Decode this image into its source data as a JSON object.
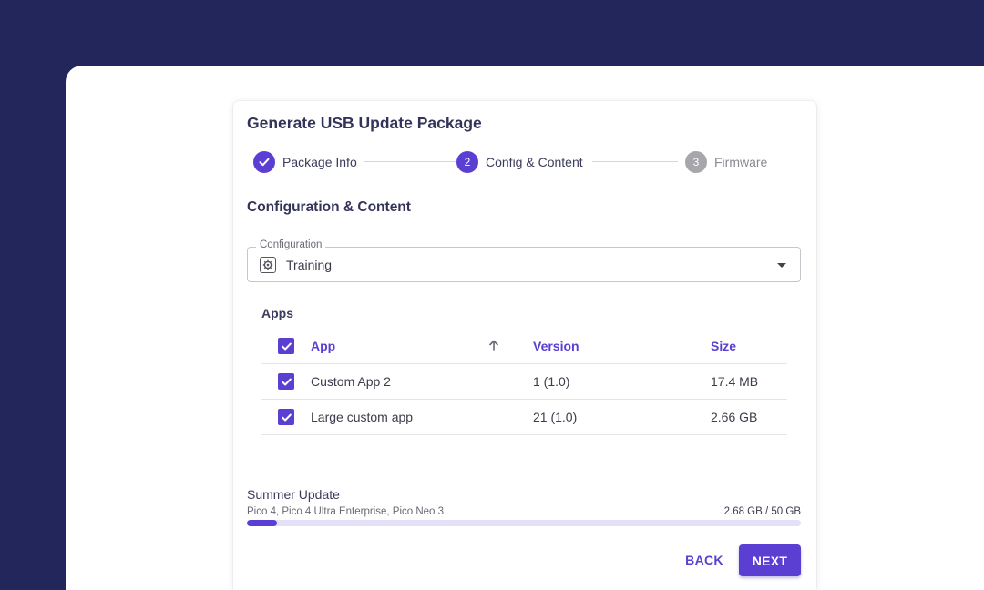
{
  "dialog": {
    "title": "Generate USB Update Package",
    "section_title": "Configuration & Content"
  },
  "stepper": {
    "steps": [
      {
        "number": "1",
        "label": "Package Info",
        "state": "done"
      },
      {
        "number": "2",
        "label": "Config & Content",
        "state": "active"
      },
      {
        "number": "3",
        "label": "Firmware",
        "state": "todo"
      }
    ]
  },
  "configuration": {
    "label": "Configuration",
    "value": "Training",
    "icon": "gear-icon"
  },
  "apps": {
    "title": "Apps",
    "columns": {
      "app": "App",
      "version": "Version",
      "size": "Size"
    },
    "rows": [
      {
        "app": "Custom App 2",
        "version": "1 (1.0)",
        "size": "17.4 MB",
        "checked": true
      },
      {
        "app": "Large custom app",
        "version": "21 (1.0)",
        "size": "2.66 GB",
        "checked": true
      }
    ]
  },
  "package": {
    "name": "Summer Update",
    "devices": "Pico 4, Pico 4 Ultra Enterprise, Pico Neo 3",
    "usage": "2.68 GB / 50 GB",
    "usage_fraction": 0.0536
  },
  "actions": {
    "back": "BACK",
    "next": "NEXT"
  },
  "colors": {
    "accent": "#5b3fd3",
    "background": "#22265a"
  }
}
